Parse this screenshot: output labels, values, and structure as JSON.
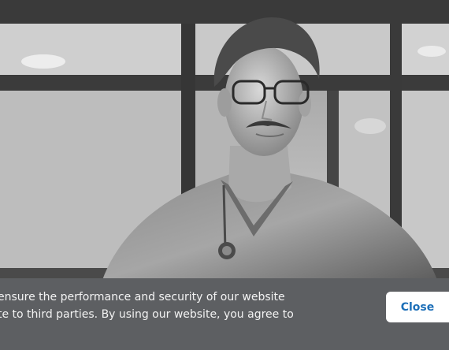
{
  "cookie_banner": {
    "text_line_1": "ensure the performance and security of our website",
    "text_line_2": "te to third parties. By using our website, you agree to",
    "close_label": "Close"
  },
  "colors": {
    "banner_background": "#5d5f62",
    "banner_text": "#f3f3f3",
    "close_text": "#1d6fb8"
  }
}
